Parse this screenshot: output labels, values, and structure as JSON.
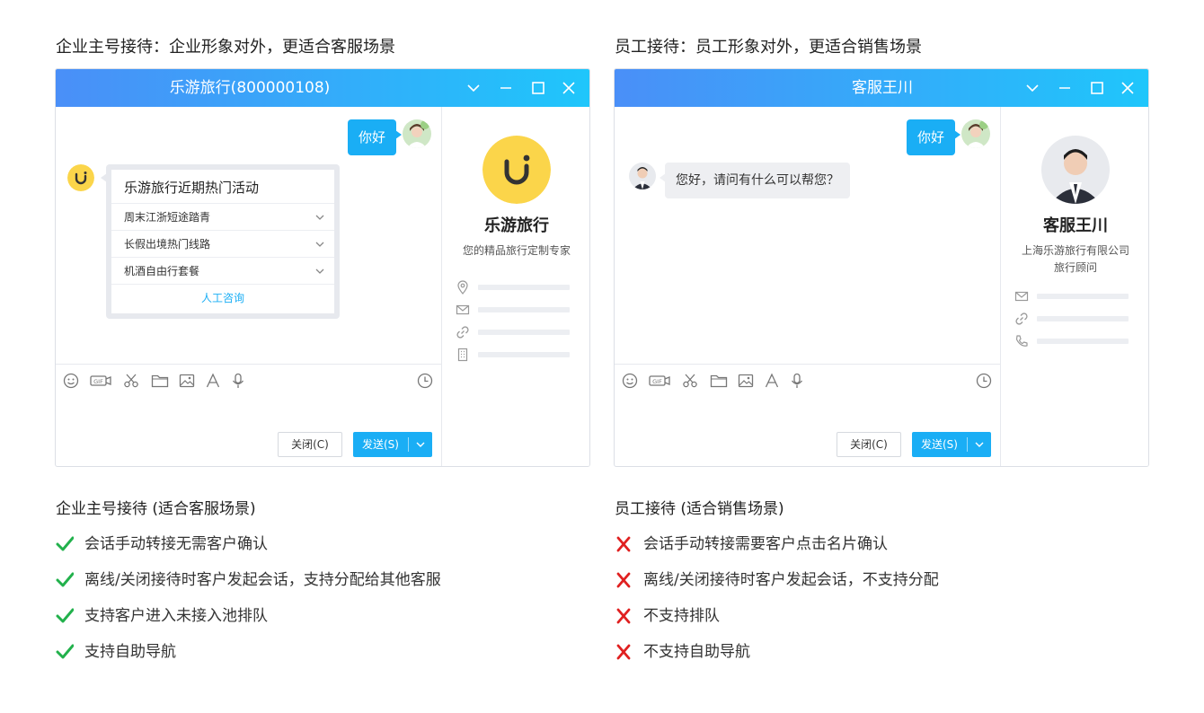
{
  "left": {
    "caption": "企业主号接待：企业形象对外，更适合客服场景",
    "window_title": "乐游旅行(800000108)",
    "greeting": "你好",
    "card": {
      "title": "乐游旅行近期热门活动",
      "items": [
        "周末江浙短途踏青",
        "长假出境热门线路",
        "机酒自由行套餐"
      ],
      "link": "人工咨询"
    },
    "close_label": "关闭(C)",
    "send_label": "发送(S)",
    "profile": {
      "name": "乐游旅行",
      "subtitle": "您的精品旅行定制专家"
    },
    "list_title": "企业主号接待 (适合客服场景)",
    "features": [
      "会话手动转接无需客户确认",
      "离线/关闭接待时客户发起会话，支持分配给其他客服",
      "支持客户进入未接入池排队",
      "支持自助导航"
    ]
  },
  "right": {
    "caption": "员工接待：员工形象对外，更适合销售场景",
    "window_title": "客服王川",
    "greeting": "你好",
    "reply": "您好，请问有什么可以帮您？",
    "close_label": "关闭(C)",
    "send_label": "发送(S)",
    "profile": {
      "name": "客服王川",
      "company": "上海乐游旅行有限公司",
      "role": "旅行顾问"
    },
    "list_title": "员工接待 (适合销售场景)",
    "features": [
      "会话手动转接需要客户点击名片确认",
      "离线/关闭接待时客户发起会话，不支持分配",
      "不支持排队",
      "不支持自助导航"
    ]
  },
  "colors": {
    "accent": "#1aaef5",
    "check": "#22b14c",
    "cross": "#e02020",
    "brand_yellow": "#fbd54a"
  },
  "icons": [
    "emoji-icon",
    "gif-icon",
    "scissors-icon",
    "folder-icon",
    "image-icon",
    "font-icon",
    "microphone-icon",
    "history-clock-icon",
    "location-icon",
    "mail-icon",
    "link-icon",
    "building-icon",
    "phone-icon",
    "check-icon",
    "cross-icon"
  ]
}
